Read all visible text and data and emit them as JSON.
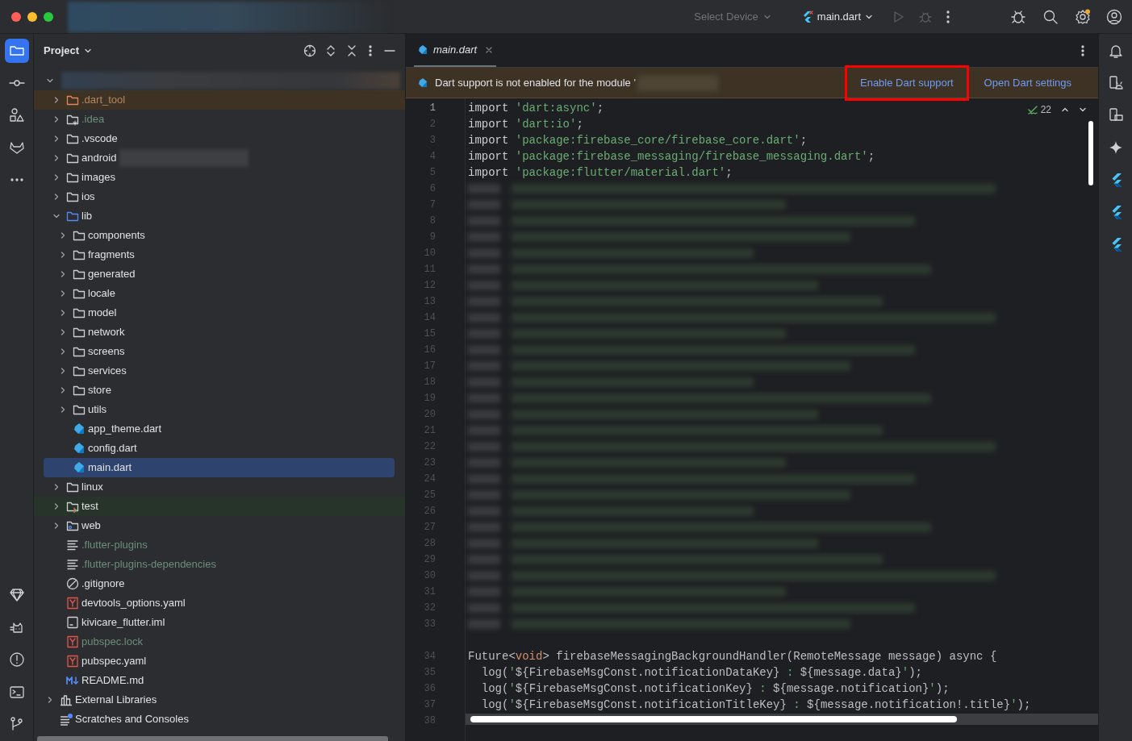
{
  "title_bar": {
    "device_selector": "Select Device",
    "run_config": "main.dart"
  },
  "left_toolbar": {
    "top": [
      {
        "kind": "project",
        "selected": true
      },
      {
        "kind": "commit",
        "selected": false
      },
      {
        "kind": "structure",
        "selected": false
      },
      {
        "kind": "gitlab",
        "selected": false
      },
      {
        "kind": "more",
        "selected": false
      }
    ],
    "bottom": [
      {
        "kind": "gem",
        "selected": false
      },
      {
        "kind": "cat",
        "selected": false
      },
      {
        "kind": "problems",
        "selected": false
      },
      {
        "kind": "terminal",
        "selected": false
      },
      {
        "kind": "git",
        "selected": false
      }
    ]
  },
  "project_panel": {
    "title": "Project",
    "tree": [
      {
        "kind": "module",
        "expanded": true,
        "redacted": true,
        "selected": false,
        "children": [
          {
            "kind": "folder_excluded",
            "label": ".dart_tool",
            "expanded": false,
            "color": "#b5875e",
            "selected": false
          },
          {
            "kind": "folder_idea",
            "label": ".idea",
            "expanded": false,
            "color": "#6c8e7a",
            "selected": false
          },
          {
            "kind": "folder",
            "label": ".vscode",
            "expanded": false,
            "color": "#dfe1e5",
            "selected": false
          },
          {
            "kind": "folder",
            "label": "android",
            "expanded": false,
            "color": "#dfe1e5",
            "selected": false,
            "redacted": true
          },
          {
            "kind": "folder",
            "label": "images",
            "expanded": false,
            "color": "#dfe1e5",
            "selected": false
          },
          {
            "kind": "folder",
            "label": "ios",
            "expanded": false,
            "color": "#dfe1e5",
            "selected": false
          },
          {
            "kind": "folder_source",
            "label": "lib",
            "expanded": true,
            "color": "#dfe1e5",
            "selected": false,
            "children": [
              {
                "kind": "folder",
                "label": "components",
                "expanded": false,
                "color": "#dfe1e5",
                "selected": false
              },
              {
                "kind": "folder",
                "label": "fragments",
                "expanded": false,
                "color": "#dfe1e5",
                "selected": false
              },
              {
                "kind": "folder",
                "label": "generated",
                "expanded": false,
                "color": "#dfe1e5",
                "selected": false
              },
              {
                "kind": "folder",
                "label": "locale",
                "expanded": false,
                "color": "#dfe1e5",
                "selected": false
              },
              {
                "kind": "folder",
                "label": "model",
                "expanded": false,
                "color": "#dfe1e5",
                "selected": false
              },
              {
                "kind": "folder",
                "label": "network",
                "expanded": false,
                "color": "#dfe1e5",
                "selected": false
              },
              {
                "kind": "folder",
                "label": "screens",
                "expanded": false,
                "color": "#dfe1e5",
                "selected": false
              },
              {
                "kind": "folder",
                "label": "services",
                "expanded": false,
                "color": "#dfe1e5",
                "selected": false
              },
              {
                "kind": "folder",
                "label": "store",
                "expanded": false,
                "color": "#dfe1e5",
                "selected": false
              },
              {
                "kind": "folder",
                "label": "utils",
                "expanded": false,
                "color": "#dfe1e5",
                "selected": false
              },
              {
                "kind": "dart",
                "label": "app_theme.dart",
                "color": "#dfe1e5",
                "selected": false
              },
              {
                "kind": "dart",
                "label": "config.dart",
                "color": "#dfe1e5",
                "selected": false
              },
              {
                "kind": "dart",
                "label": "main.dart",
                "color": "#dfe1e5",
                "selected": true
              }
            ]
          },
          {
            "kind": "folder",
            "label": "linux",
            "expanded": false,
            "color": "#dfe1e5",
            "selected": false
          },
          {
            "kind": "folder_test",
            "label": "test",
            "expanded": false,
            "color": "#dfe1e5",
            "selected": false
          },
          {
            "kind": "folder_web",
            "label": "web",
            "expanded": false,
            "color": "#dfe1e5",
            "selected": false
          },
          {
            "kind": "text",
            "label": ".flutter-plugins",
            "color": "#6c8e7a",
            "selected": false
          },
          {
            "kind": "text",
            "label": ".flutter-plugins-dependencies",
            "color": "#6c8e7a",
            "selected": false
          },
          {
            "kind": "ignore",
            "label": ".gitignore",
            "color": "#dfe1e5",
            "selected": false
          },
          {
            "kind": "yaml",
            "label": "devtools_options.yaml",
            "color": "#dfe1e5",
            "selected": false
          },
          {
            "kind": "iml",
            "label": "kivicare_flutter.iml",
            "color": "#dfe1e5",
            "selected": false
          },
          {
            "kind": "yaml",
            "label": "pubspec.lock",
            "color": "#6c8e7a",
            "selected": false
          },
          {
            "kind": "yaml",
            "label": "pubspec.yaml",
            "color": "#dfe1e5",
            "selected": false
          },
          {
            "kind": "markdown",
            "label": "README.md",
            "color": "#dfe1e5",
            "selected": false
          }
        ]
      },
      {
        "kind": "libraries",
        "label": "External Libraries",
        "expanded": false,
        "color": "#dfe1e5",
        "selected": false
      },
      {
        "kind": "scratches",
        "label": "Scratches and Consoles",
        "color": "#dfe1e5",
        "selected": false
      }
    ]
  },
  "editor": {
    "tabs": [
      {
        "label": "main.dart",
        "selected": true
      }
    ],
    "banner": {
      "message": "Dart support is not enabled for the module '",
      "actions": [
        {
          "label": "Enable Dart support",
          "annotated": true
        },
        {
          "label": "Open Dart settings",
          "annotated": false
        }
      ]
    },
    "inspection_count": "22",
    "lines": [
      {
        "number": "1",
        "tokens": [
          {
            "t": "import ",
            "kind": "keyword"
          },
          {
            "t": "'dart:async'",
            "kind": "string"
          },
          {
            "t": ";",
            "kind": "plain"
          }
        ]
      },
      {
        "number": "2",
        "tokens": [
          {
            "t": "import ",
            "kind": "keyword"
          },
          {
            "t": "'dart:io'",
            "kind": "string"
          },
          {
            "t": ";",
            "kind": "plain"
          }
        ]
      },
      {
        "number": "3",
        "tokens": [
          {
            "t": "import ",
            "kind": "keyword"
          },
          {
            "t": "'package:firebase_core/firebase_core.dart'",
            "kind": "string"
          },
          {
            "t": ";",
            "kind": "plain"
          }
        ]
      },
      {
        "number": "4",
        "tokens": [
          {
            "t": "import ",
            "kind": "keyword"
          },
          {
            "t": "'package:firebase_messaging/firebase_messaging.dart'",
            "kind": "string"
          },
          {
            "t": ";",
            "kind": "plain"
          }
        ]
      },
      {
        "number": "5",
        "tokens": [
          {
            "t": "import ",
            "kind": "keyword"
          },
          {
            "t": "'package:flutter/material.dart'",
            "kind": "string"
          },
          {
            "t": ";",
            "kind": "plain"
          }
        ]
      },
      {
        "number": "6",
        "redacted": true
      },
      {
        "number": "7",
        "redacted": true
      },
      {
        "number": "8",
        "redacted": true
      },
      {
        "number": "9",
        "redacted": true
      },
      {
        "number": "10",
        "redacted": true
      },
      {
        "number": "11",
        "redacted": true
      },
      {
        "number": "12",
        "redacted": true
      },
      {
        "number": "13",
        "redacted": true
      },
      {
        "number": "14",
        "redacted": true
      },
      {
        "number": "15",
        "redacted": true
      },
      {
        "number": "16",
        "redacted": true
      },
      {
        "number": "17",
        "redacted": true
      },
      {
        "number": "18",
        "redacted": true
      },
      {
        "number": "19",
        "redacted": true
      },
      {
        "number": "20",
        "redacted": true
      },
      {
        "number": "21",
        "redacted": true
      },
      {
        "number": "22",
        "redacted": true
      },
      {
        "number": "23",
        "redacted": true
      },
      {
        "number": "24",
        "redacted": true
      },
      {
        "number": "25",
        "redacted": true
      },
      {
        "number": "26",
        "redacted": true
      },
      {
        "number": "27",
        "redacted": true
      },
      {
        "number": "28",
        "redacted": true
      },
      {
        "number": "29",
        "redacted": true
      },
      {
        "number": "30",
        "redacted": true
      },
      {
        "number": "31",
        "redacted": true
      },
      {
        "number": "32",
        "redacted": true
      },
      {
        "number": "33",
        "redacted": true,
        "gap_after": true
      },
      {
        "number": "34",
        "tokens": [
          {
            "t": "Future<",
            "kind": "plain"
          },
          {
            "t": "void",
            "kind": "type"
          },
          {
            "t": "> firebaseMessagingBackgroundHandler(RemoteMessage message) async {",
            "kind": "plain"
          }
        ]
      },
      {
        "number": "35",
        "tokens": [
          {
            "t": "  log(",
            "kind": "plain"
          },
          {
            "t": "'",
            "kind": "string"
          },
          {
            "t": "${FirebaseMsgConst.notificationDataKey}",
            "kind": "plain"
          },
          {
            "t": " : ",
            "kind": "string"
          },
          {
            "t": "${message.data}",
            "kind": "plain"
          },
          {
            "t": "'",
            "kind": "string"
          },
          {
            "t": ");",
            "kind": "plain"
          }
        ]
      },
      {
        "number": "36",
        "tokens": [
          {
            "t": "  log(",
            "kind": "plain"
          },
          {
            "t": "'",
            "kind": "string"
          },
          {
            "t": "${FirebaseMsgConst.notificationKey}",
            "kind": "plain"
          },
          {
            "t": " : ",
            "kind": "string"
          },
          {
            "t": "${message.notification}",
            "kind": "plain"
          },
          {
            "t": "'",
            "kind": "string"
          },
          {
            "t": ");",
            "kind": "plain"
          }
        ]
      },
      {
        "number": "37",
        "tokens": [
          {
            "t": "  log(",
            "kind": "plain"
          },
          {
            "t": "'",
            "kind": "string"
          },
          {
            "t": "${FirebaseMsgConst.notificationTitleKey}",
            "kind": "plain"
          },
          {
            "t": " : ",
            "kind": "string"
          },
          {
            "t": "${message.notification!.title}",
            "kind": "plain"
          },
          {
            "t": "'",
            "kind": "string"
          },
          {
            "t": ");",
            "kind": "plain"
          }
        ]
      },
      {
        "number": "38"
      }
    ]
  },
  "right_toolbar": [
    {
      "kind": "bell"
    },
    {
      "kind": "android"
    },
    {
      "kind": "device"
    },
    {
      "kind": "sparkle"
    },
    {
      "kind": "flutter"
    },
    {
      "kind": "flutter"
    },
    {
      "kind": "flutter"
    }
  ]
}
